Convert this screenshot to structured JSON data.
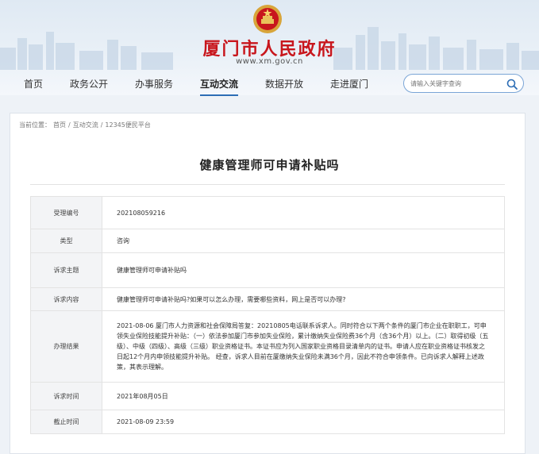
{
  "site": {
    "title": "厦门市人民政府",
    "domain": "www.xm.gov.cn"
  },
  "nav": {
    "items": [
      {
        "label": "首页"
      },
      {
        "label": "政务公开"
      },
      {
        "label": "办事服务"
      },
      {
        "label": "互动交流",
        "active": true
      },
      {
        "label": "数据开放"
      },
      {
        "label": "走进厦门"
      }
    ],
    "search_placeholder": "请输入关键字查询"
  },
  "breadcrumb": {
    "prefix": "当前位置：",
    "items": [
      "首页",
      "互动交流",
      "12345便民平台"
    ],
    "separator": "/"
  },
  "page_title": "健康管理师可申请补贴吗",
  "detail": {
    "rows": [
      {
        "label": "受理编号",
        "value": "202108059216"
      },
      {
        "label": "类型",
        "value": "咨询"
      },
      {
        "label": "诉求主题",
        "value": "健康管理师可申请补贴吗"
      },
      {
        "label": "诉求内容",
        "value": "健康管理师可申请补贴吗?如果可以怎么办理，需要哪些资料，网上是否可以办理?"
      },
      {
        "label": "办理结果",
        "value": "2021-08-06 厦门市人力资源和社会保障局答复：20210805电话联系诉求人。同时符合以下两个条件的厦门市企业在职职工，可申领失业保险技能提升补贴：（一）依法参加厦门市参加失业保险，累计缴纳失业保险费36个月（含36个月）以上。（二）取得初级（五级）、中级（四级）、高级（三级）职业资格证书。本证书应为列入国家职业资格目录清单内的证书。申请人应在职业资格证书核发之日起12个月内申领技能提升补贴。 经查，诉求人目前在厦缴纳失业保险未满36个月，因此不符合申领条件。已向诉求人解释上述政策，其表示理解。"
      },
      {
        "label": "诉求时间",
        "value": "2021年08月05日"
      },
      {
        "label": "截止时间",
        "value": "2021-08-09 23:59"
      }
    ]
  },
  "colors": {
    "brand_red": "#c8161d",
    "nav_accent": "#2c6db5",
    "label_bg": "#f3f4f6"
  }
}
